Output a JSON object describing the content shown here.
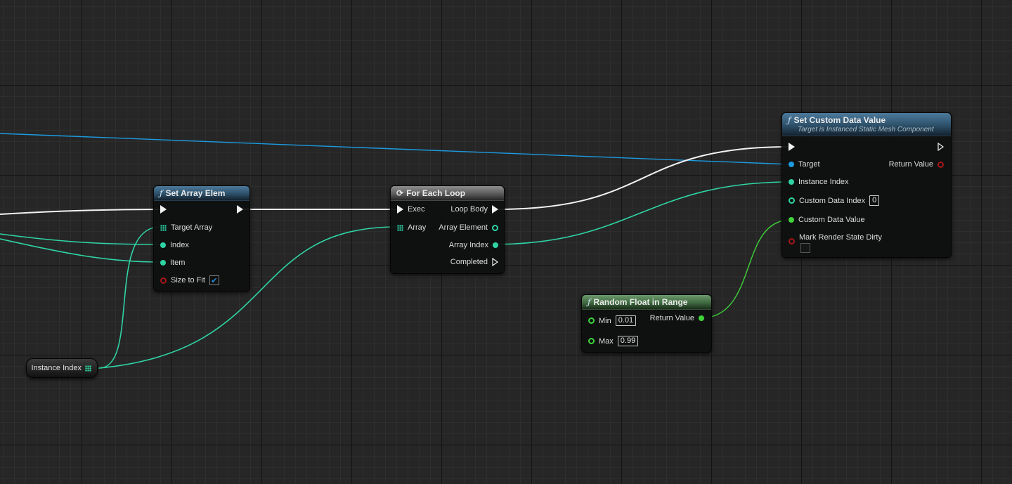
{
  "colors": {
    "exec_wire": "#f2f2f2",
    "int_wire": "#2fd4a4",
    "object_wire": "#1c9be0",
    "float_wire": "#3ed43a",
    "bool_pin": "#a51616"
  },
  "nodes": {
    "set_array_elem": {
      "title": "Set Array Elem",
      "icon": "function-icon",
      "pins": {
        "target_array": "Target Array",
        "index": "Index",
        "item": "Item",
        "size_to_fit": "Size to Fit",
        "size_to_fit_checked": true
      }
    },
    "for_each_loop": {
      "title": "For Each Loop",
      "icon": "loop-icon",
      "pins": {
        "exec": "Exec",
        "array": "Array",
        "loop_body": "Loop Body",
        "array_element": "Array Element",
        "array_index": "Array Index",
        "completed": "Completed"
      }
    },
    "set_custom_data_value": {
      "title": "Set Custom Data Value",
      "subtitle": "Target is Instanced Static Mesh Component",
      "icon": "function-icon",
      "pins": {
        "target": "Target",
        "instance_index": "Instance Index",
        "custom_data_index": "Custom Data Index",
        "custom_data_index_value": "0",
        "custom_data_value": "Custom Data Value",
        "mark_render_state_dirty": "Mark Render State Dirty",
        "return_value": "Return Value"
      }
    },
    "random_float_in_range": {
      "title": "Random Float in Range",
      "icon": "function-icon",
      "pins": {
        "min": "Min",
        "min_value": "0.01",
        "max": "Max",
        "max_value": "0.99",
        "return_value": "Return Value"
      }
    },
    "instance_index_var": {
      "label": "Instance Index",
      "icon": "array-grid-icon"
    }
  }
}
